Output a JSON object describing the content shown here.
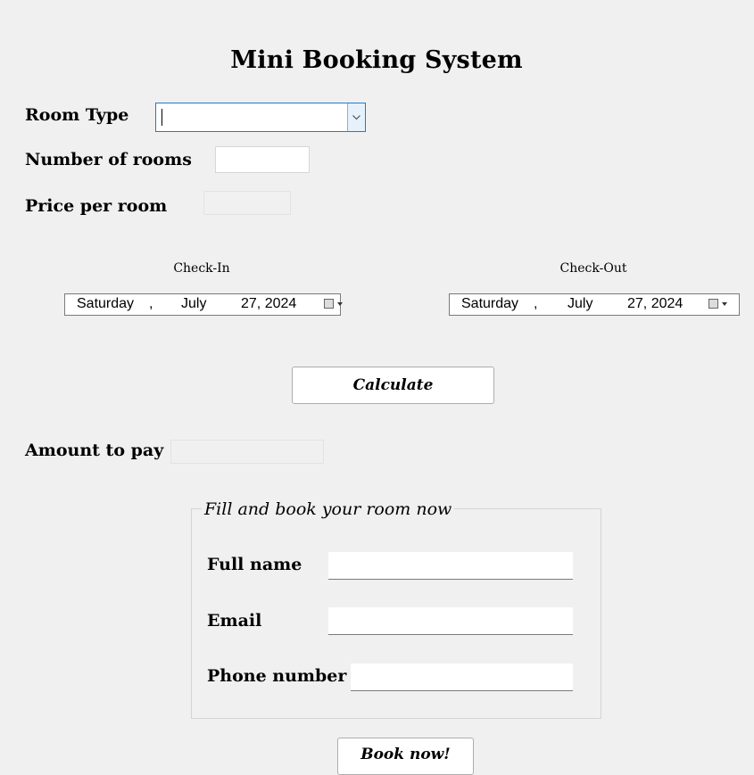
{
  "title": "Mini Booking System",
  "room_type": {
    "label": "Room Type",
    "value": ""
  },
  "num_rooms": {
    "label": "Number of rooms",
    "value": ""
  },
  "price_per_room": {
    "label": "Price per room",
    "value": ""
  },
  "check_in": {
    "label": "Check-In",
    "weekday": "Saturday",
    "sep": ",",
    "month": "July",
    "day_year": "27, 2024"
  },
  "check_out": {
    "label": "Check-Out",
    "weekday": "Saturday",
    "sep": ",",
    "month": "July",
    "day_year": "27, 2024"
  },
  "calculate_button": "Calculate",
  "amount": {
    "label": "Amount to pay",
    "value": ""
  },
  "booking_group": {
    "legend": "Fill and book your room now",
    "full_name_label": "Full name",
    "email_label": "Email",
    "phone_label": "Phone number"
  },
  "book_button": "Book now!",
  "colors": {
    "background": "#f0f0f0",
    "focus_border": "#1f7ad3"
  }
}
